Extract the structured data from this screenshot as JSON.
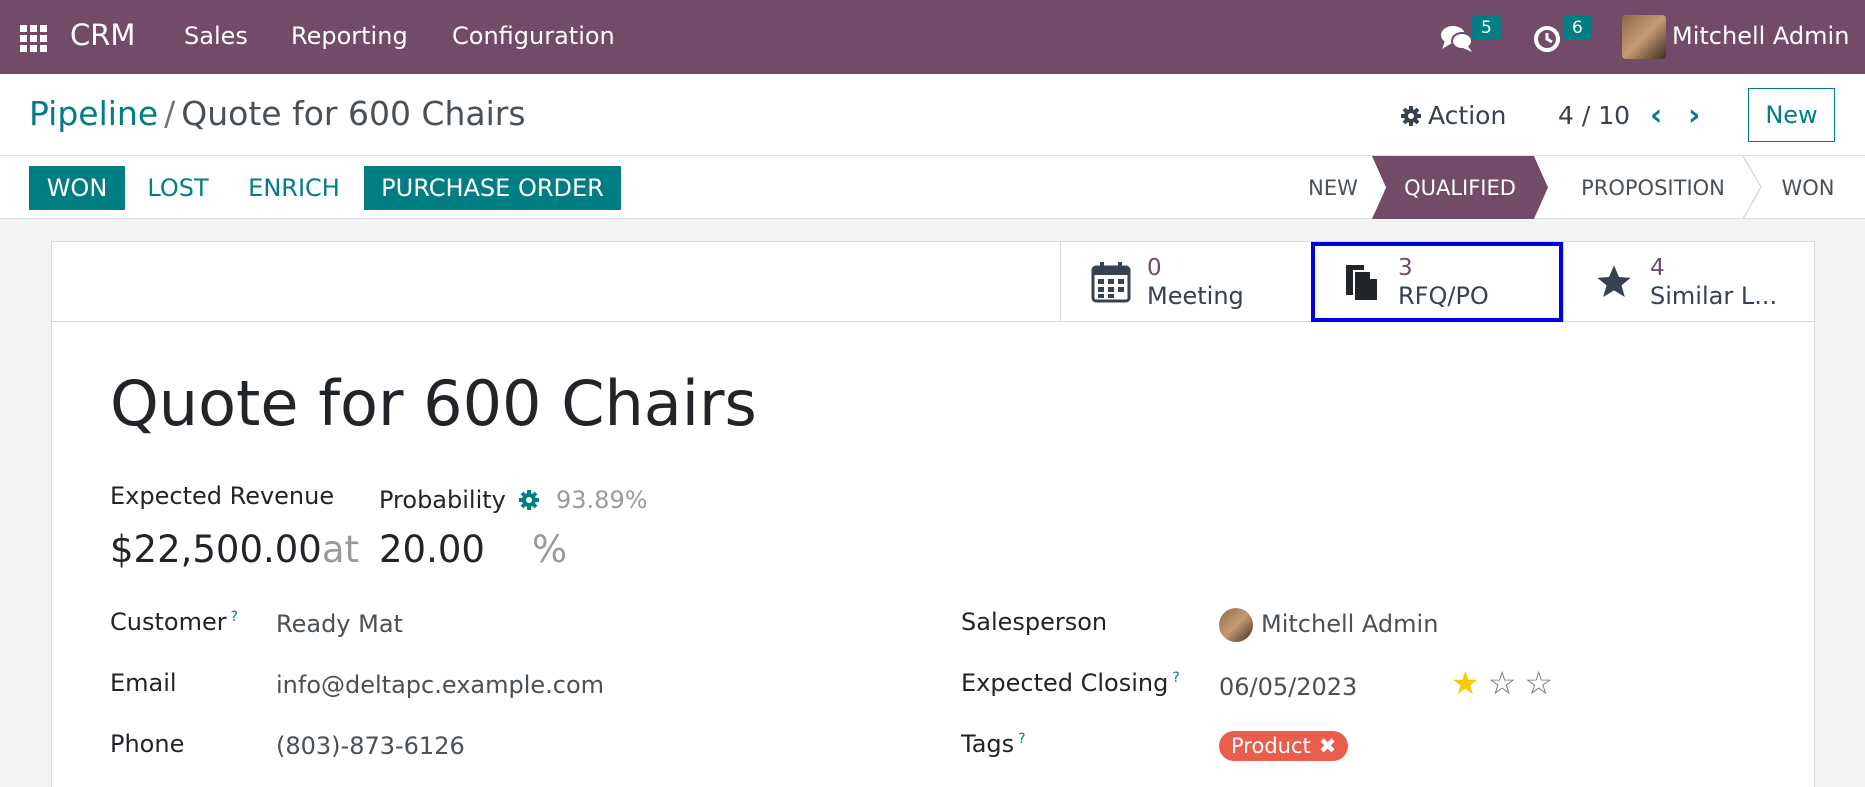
{
  "navbar": {
    "brand": "CRM",
    "menu": [
      "Sales",
      "Reporting",
      "Configuration"
    ],
    "messages_count": "5",
    "activities_count": "6",
    "user_name": "Mitchell Admin"
  },
  "breadcrumb": {
    "parent": "Pipeline",
    "separator": "/",
    "current": "Quote for 600 Chairs"
  },
  "control": {
    "action_label": "Action",
    "pager": "4 / 10",
    "new_label": "New"
  },
  "statusbar": {
    "buttons": [
      "WON",
      "LOST",
      "ENRICH",
      "PURCHASE ORDER"
    ],
    "stages": [
      "NEW",
      "QUALIFIED",
      "PROPOSITION",
      "WON"
    ],
    "active_stage": "QUALIFIED"
  },
  "smart_buttons": [
    {
      "count": "0",
      "label": "Meeting",
      "icon": "calendar-icon"
    },
    {
      "count": "3",
      "label": "RFQ/PO",
      "icon": "document-icon"
    },
    {
      "count": "4",
      "label": "Similar L...",
      "icon": "star-icon"
    }
  ],
  "record": {
    "title": "Quote for 600 Chairs",
    "expected_revenue_label": "Expected Revenue",
    "expected_revenue": "$22,500.00",
    "at_label": "at",
    "probability_label": "Probability",
    "probability_auto": "93.89%",
    "probability": "20.00",
    "percent_sign": "%",
    "customer_label": "Customer",
    "customer": "Ready Mat",
    "email_label": "Email",
    "email": "info@deltapc.example.com",
    "phone_label": "Phone",
    "phone": "(803)-873-6126",
    "salesperson_label": "Salesperson",
    "salesperson": "Mitchell Admin",
    "closing_label": "Expected Closing",
    "closing": "06/05/2023",
    "priority_stars": 1,
    "tags_label": "Tags",
    "tags": [
      "Product"
    ],
    "help_mark": "?"
  },
  "colors": {
    "brand": "#714b67",
    "accent": "#017e84",
    "tag": "#e85d4c",
    "star": "#f3cc00"
  }
}
